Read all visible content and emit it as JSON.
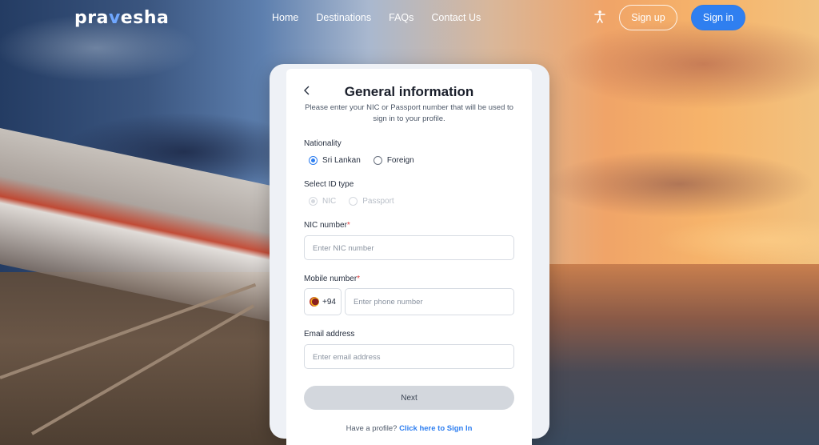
{
  "header": {
    "logo_text_a": "pra",
    "logo_pin": "v",
    "logo_text_b": "esha",
    "nav": [
      "Home",
      "Destinations",
      "FAQs",
      "Contact Us"
    ],
    "signup_label": "Sign up",
    "signin_label": "Sign in",
    "accessibility_icon": "accessibility-icon"
  },
  "form": {
    "title": "General information",
    "subtitle": "Please enter your NIC or Passport number that will be used to sign in to your profile.",
    "nationality_label": "Nationality",
    "nationality_options": [
      "Sri Lankan",
      "Foreign"
    ],
    "nationality_selected": "Sri Lankan",
    "id_type_label": "Select ID type",
    "id_type_options": [
      "NIC",
      "Passport"
    ],
    "nic_label": "NIC number",
    "nic_required": "*",
    "nic_placeholder": "Enter NIC number",
    "mobile_label": "Mobile number",
    "mobile_required": "*",
    "country_code": "+94",
    "phone_placeholder": "Enter phone number",
    "email_label": "Email address",
    "email_placeholder": "Enter email address",
    "next_label": "Next",
    "footer_text": "Have a profile?",
    "footer_link": "Click here to Sign In"
  },
  "colors": {
    "accent": "#2f7ff0",
    "required": "#e23b3b",
    "disabled_button": "#d3d7dd"
  }
}
